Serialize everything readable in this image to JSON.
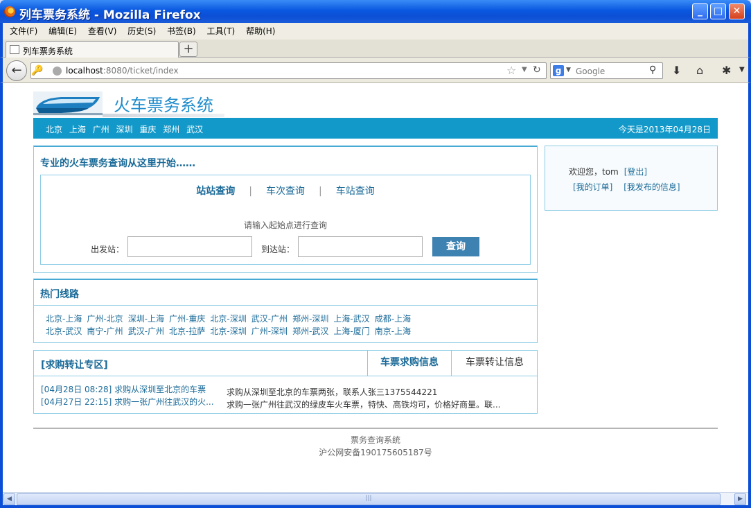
{
  "window": {
    "title": "列车票务系统 - Mozilla Firefox",
    "minimize": "_",
    "maximize": "□",
    "close": "✕"
  },
  "menu": [
    "文件(F)",
    "编辑(E)",
    "查看(V)",
    "历史(S)",
    "书签(B)",
    "工具(T)",
    "帮助(H)"
  ],
  "tab": {
    "label": "列车票务系统",
    "new_tab": "+"
  },
  "nav": {
    "back": "←",
    "url_host": "localhost",
    "url_rest": ":8080/ticket/index",
    "search_placeholder": "Google"
  },
  "site": {
    "title": "火车票务系统",
    "cities": [
      "北京",
      "上海",
      "广州",
      "深圳",
      "重庆",
      "郑州",
      "武汉"
    ],
    "today": "今天是2013年04月28日"
  },
  "query": {
    "title": "专业的火车票务查询从这里开始……",
    "tabs": [
      "站站查询",
      "车次查询",
      "车站查询"
    ],
    "tab_separator": "|",
    "hint": "请输入起始点进行查询",
    "from_label": "出发站：",
    "to_label": "到达站：",
    "from_value": "",
    "to_value": "",
    "search_button": "查询"
  },
  "hot_routes": {
    "title": "热门线路",
    "rows": [
      [
        "北京-上海",
        "广州-北京",
        "深圳-上海",
        "广州-重庆",
        "北京-深圳",
        "武汉-广州",
        "郑州-深圳",
        "上海-武汉",
        "成都-上海"
      ],
      [
        "北京-武汉",
        "南宁-广州",
        "武汉-广州",
        "北京-拉萨",
        "北京-深圳",
        "广州-深圳",
        "郑州-武汉",
        "上海-厦门",
        "南京-上海"
      ]
    ]
  },
  "buy_transfer": {
    "title": "[求购转让专区]",
    "tab_buy": "车票求购信息",
    "tab_transfer": "车票转让信息",
    "messages": [
      {
        "link": "[04月28日 08:28] 求购从深圳至北京的车票",
        "desc": "求购从深圳至北京的车票两张，联系人张三1375544221"
      },
      {
        "link": "[04月27日 22:15] 求购一张广州往武汉的火...",
        "desc": "求购一张广州往武汉的绿皮车火车票，特快、高铁均可，价格好商量。联..."
      }
    ]
  },
  "user": {
    "welcome": "欢迎您，tom",
    "logout": "[登出]",
    "my_orders": "[我的订单]",
    "my_posts": "[我发布的信息]"
  },
  "footer": {
    "line1": "票务查询系统",
    "line2": "沪公网安备190175605187号"
  }
}
